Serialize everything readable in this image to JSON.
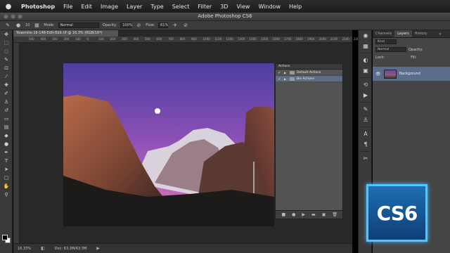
{
  "menubar": {
    "app_name": "Photoshop",
    "items": [
      "File",
      "Edit",
      "Image",
      "Layer",
      "Type",
      "Select",
      "Filter",
      "3D",
      "View",
      "Window",
      "Help"
    ]
  },
  "window": {
    "title": "Adobe Photoshop CS6"
  },
  "options_bar": {
    "mode_label": "Mode:",
    "mode_value": "Normal",
    "opacity_label": "Opacity:",
    "opacity_value": "100%",
    "flow_label": "Flow:",
    "flow_value": "61%",
    "brush_size": "10"
  },
  "document": {
    "tab_label": "Yosemite-16-148-Edit-Edit.tif @ 16.3% (RGB/16*)",
    "ruler_ticks": [
      "500",
      "400",
      "300",
      "200",
      "100",
      "0",
      "100",
      "200",
      "300",
      "400",
      "500",
      "600",
      "700",
      "800",
      "900",
      "1000",
      "1100",
      "1200",
      "1300",
      "1400",
      "1500",
      "1600",
      "1700",
      "1800",
      "1900",
      "2000",
      "2100",
      "2200",
      "2300"
    ],
    "zoom": "16.33%",
    "doc_size": "Doc: 63.3M/63.3M"
  },
  "actions_panel": {
    "title": "Actions",
    "rows": [
      {
        "label": "Default Actions",
        "checked": true,
        "expanded": false,
        "selected": false
      },
      {
        "label": "Bio Actions",
        "checked": true,
        "expanded": false,
        "selected": true
      }
    ]
  },
  "layers_panel": {
    "tabs": [
      "Channels",
      "Layers",
      "History"
    ],
    "active_tab": "Layers",
    "kind_value": "Kind",
    "blend_value": "Normal",
    "opacity_label": "Opacity:",
    "lock_label": "Lock:",
    "fill_label": "Fill:",
    "layer_name": "Background"
  },
  "logo": {
    "text": "CS6"
  },
  "colors": {
    "accent": "#4fc6ff",
    "selection": "#5a6e8c",
    "panel": "#535353"
  }
}
